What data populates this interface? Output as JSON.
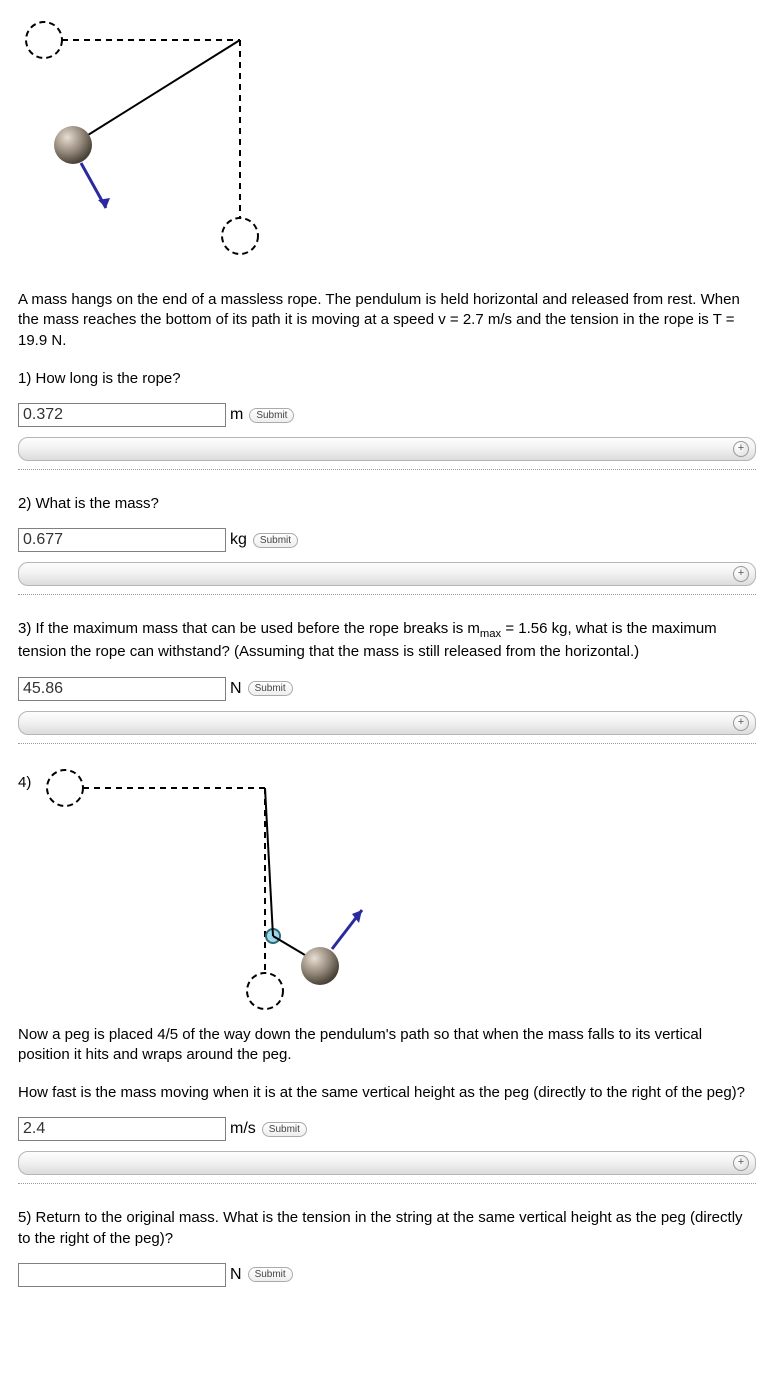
{
  "intro": "A mass hangs on the end of a massless rope. The pendulum is held horizontal and released from rest. When the mass reaches the bottom of its path it is moving at a speed v = 2.7 m/s and the tension in the rope is T = 19.9 N.",
  "q1": {
    "label": "1) How long is the rope?",
    "value": "0.372",
    "unit": "m",
    "submit": "Submit"
  },
  "q2": {
    "label": "2) What is the mass?",
    "value": "0.677",
    "unit": "kg",
    "submit": "Submit"
  },
  "q3": {
    "label_pre": "3) If the maximum mass that can be used before the rope breaks is m",
    "label_sub": "max",
    "label_post": " = 1.56 kg, what is the maximum tension the rope can withstand? (Assuming that the mass is still released from the horizontal.)",
    "value": "45.86",
    "unit": "N",
    "submit": "Submit"
  },
  "q4": {
    "num": "4)",
    "intro": "Now a peg is placed 4/5 of the way down the pendulum's path so that when the mass falls to its vertical position it hits and wraps around the peg.",
    "label": "How fast is the mass moving when it is at the same vertical height as the peg (directly to the right of the peg)?",
    "value": "2.4",
    "unit": "m/s",
    "submit": "Submit"
  },
  "q5": {
    "label": "5) Return to the original mass. What is the tension in the string at the same vertical height as the peg (directly to the right of the peg)?",
    "value": "",
    "unit": "N",
    "submit": "Submit"
  },
  "plus": "+"
}
